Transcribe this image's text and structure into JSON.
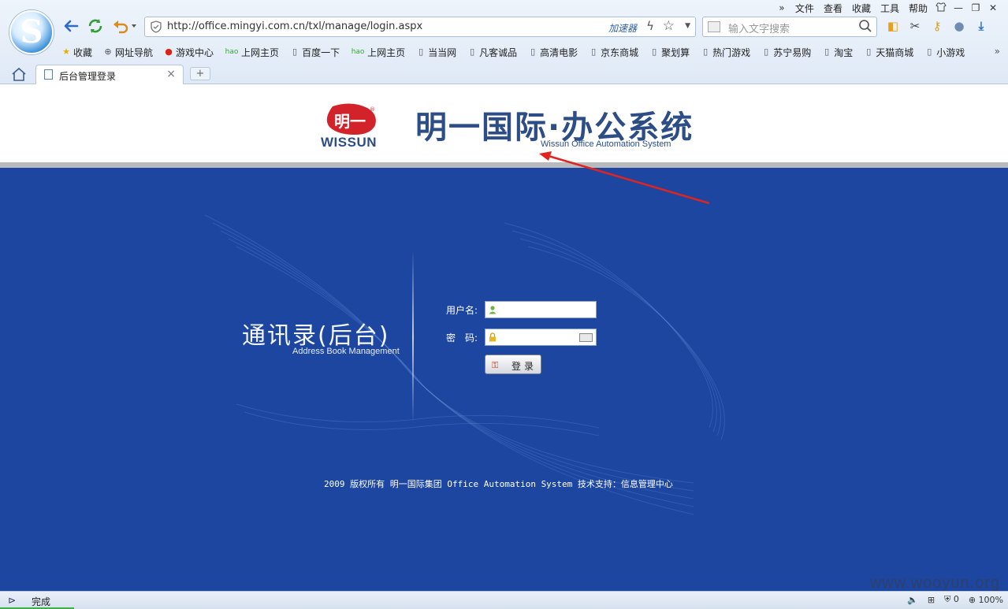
{
  "browser": {
    "menu": [
      "文件",
      "查看",
      "收藏",
      "工具",
      "帮助"
    ],
    "url": "http://office.mingyi.com.cn/txl/manage/login.aspx",
    "accelerator_label": "加速器",
    "search_placeholder": "输入文字搜索",
    "bookmarks": [
      "收藏",
      "网址导航",
      "游戏中心",
      "上网主页",
      "百度一下",
      "上网主页",
      "当当网",
      "凡客诚品",
      "高清电影",
      "京东商城",
      "聚划算",
      "热门游戏",
      "苏宁易购",
      "淘宝",
      "天猫商城",
      "小游戏"
    ],
    "tab_title": "后台管理登录",
    "new_tab": "+",
    "more": "»"
  },
  "page": {
    "brand_logo_text": "明一",
    "brand_logo_latin": "WISSUN",
    "brand_title": "明一国际·办公系统",
    "brand_subtitle": "Wissun Office Automation System",
    "app_title": "通讯录(后台)",
    "app_subtitle": "Address Book Management",
    "username_label": "用户名:",
    "password_label": "密　码:",
    "username_value": "",
    "password_value": "",
    "login_button": "登录",
    "footer": "2009 版权所有 明一国际集团 Office Automation System   技术支持：信息管理中心"
  },
  "status": {
    "text": "完成",
    "count": "0",
    "zoom": "100%",
    "watermark": "www.wooyun.org"
  },
  "colors": {
    "page_blue": "#1d46a0",
    "brand_blue": "#2c4d85",
    "brand_red": "#d2232a"
  }
}
